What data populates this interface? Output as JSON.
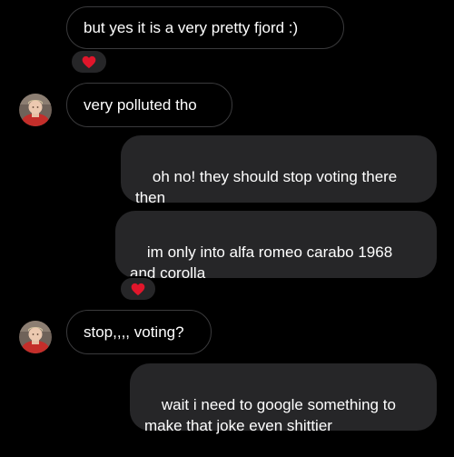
{
  "messages": [
    {
      "sender": "other",
      "text": "but yes it is a very pretty fjord :)"
    },
    {
      "sender": "other",
      "text": "very polluted tho"
    },
    {
      "sender": "me",
      "text": "oh no! they should stop voting there then"
    },
    {
      "sender": "me",
      "text": "im only into alfa romeo carabo 1968 and corolla"
    },
    {
      "sender": "other",
      "text": "stop,,,, voting?"
    },
    {
      "sender": "me",
      "text": "wait i need to google something to make that joke even shittier"
    }
  ],
  "reactions": [
    {
      "message_index": 0,
      "emoji": "heart-icon"
    },
    {
      "message_index": 3,
      "emoji": "heart-icon"
    }
  ],
  "colors": {
    "background": "#000000",
    "received_border": "#3a3a3c",
    "sent_bubble": "#262628",
    "reaction_heart": "#e0162b",
    "text": "#ffffff"
  }
}
